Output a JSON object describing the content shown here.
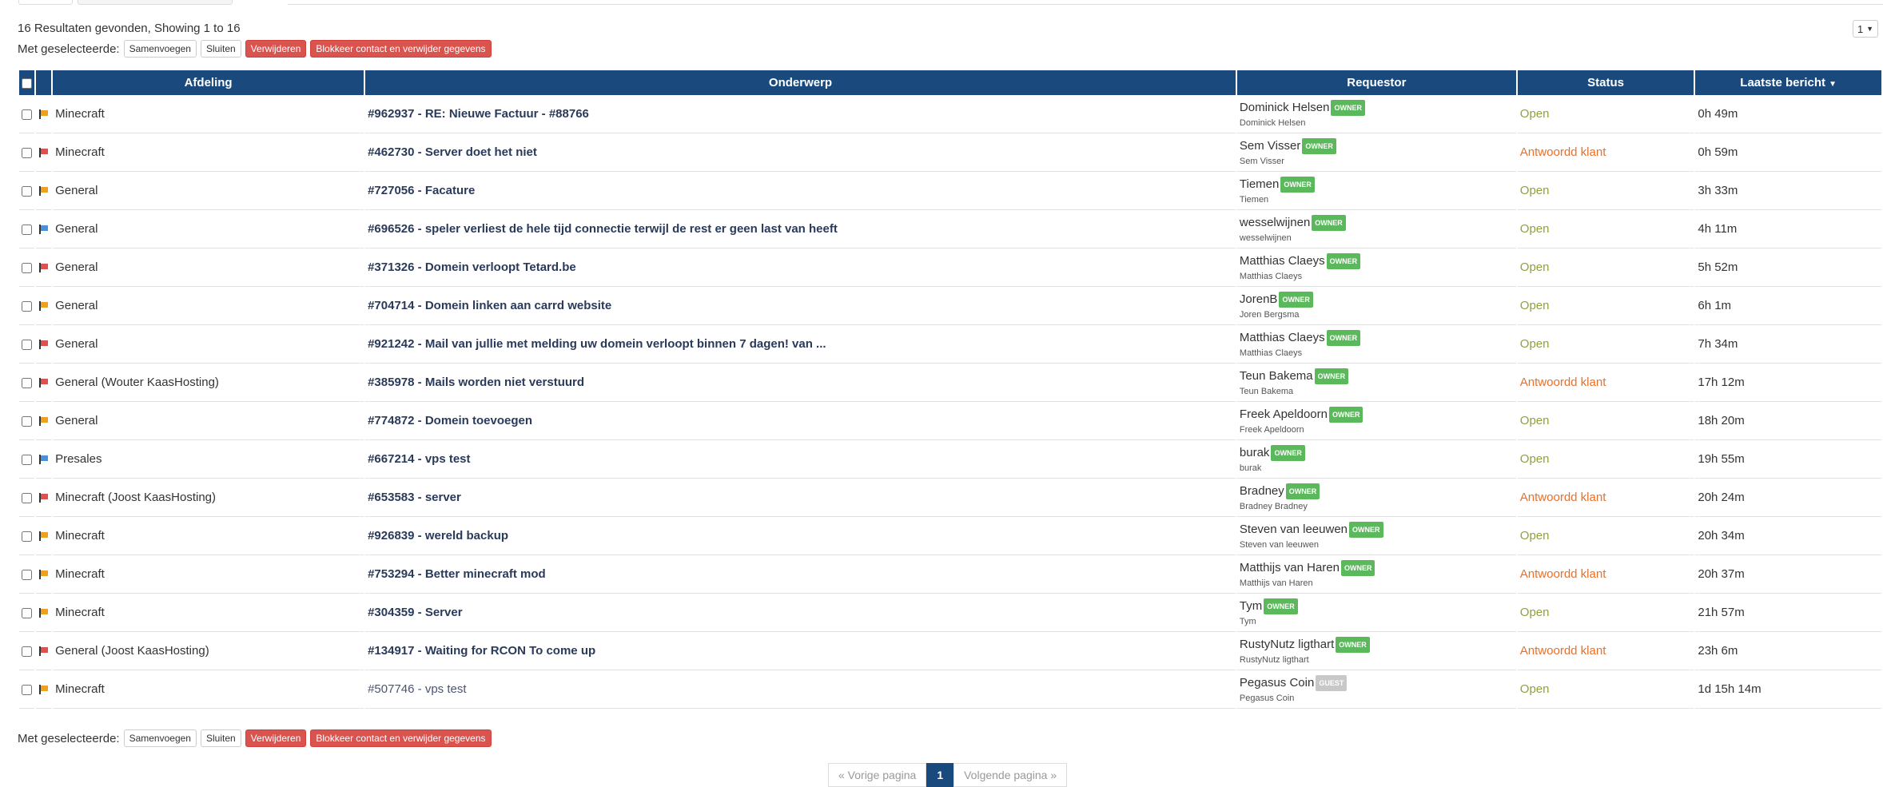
{
  "summary": "16 Resultaten gevonden, Showing 1 to 16",
  "page_select": "1",
  "mass_actions": {
    "label": "Met geselecteerde:",
    "merge": "Samenvoegen",
    "close": "Sluiten",
    "delete": "Verwijderen",
    "block": "Blokkeer contact en verwijder gegevens"
  },
  "columns": {
    "department": "Afdeling",
    "subject": "Onderwerp",
    "requestor": "Requestor",
    "status": "Status",
    "last_reply": "Laatste bericht"
  },
  "sort_icon": "caret-down-icon",
  "colors": {
    "header": "#1a4a7d",
    "open": "#8ca23a",
    "awaiting": "#e8702a",
    "owner_badge": "#5cb85c",
    "flag_orange": "#f0a020",
    "flag_red": "#d9534f",
    "flag_blue": "#4a90d9"
  },
  "tickets": [
    {
      "flag": "orange",
      "department": "Minecraft",
      "subject": "#962937 - RE: Nieuwe Factuur - #88766",
      "name": "Dominick Helsen",
      "badge": "OWNER",
      "sub": "Dominick Helsen",
      "status": "Open",
      "last": "0h 49m"
    },
    {
      "flag": "red",
      "department": "Minecraft",
      "subject": "#462730 - Server doet het niet",
      "name": "Sem Visser",
      "badge": "OWNER",
      "sub": "Sem Visser",
      "status": "Antwoordd klant",
      "last": "0h 59m"
    },
    {
      "flag": "orange",
      "department": "General",
      "subject": "#727056 - Facature",
      "name": "Tiemen",
      "badge": "OWNER",
      "sub": "Tiemen",
      "status": "Open",
      "last": "3h 33m"
    },
    {
      "flag": "blue",
      "department": "General",
      "subject": "#696526 - speler verliest de hele tijd connectie terwijl de rest er geen last van heeft",
      "name": "wesselwijnen",
      "badge": "OWNER",
      "sub": "wesselwijnen",
      "status": "Open",
      "last": "4h 11m"
    },
    {
      "flag": "red",
      "department": "General",
      "subject": "#371326 - Domein verloopt Tetard.be",
      "name": "Matthias Claeys",
      "badge": "OWNER",
      "sub": "Matthias Claeys",
      "status": "Open",
      "last": "5h 52m"
    },
    {
      "flag": "orange",
      "department": "General",
      "subject": "#704714 - Domein linken aan carrd website",
      "name": "JorenB",
      "badge": "OWNER",
      "sub": "Joren Bergsma",
      "status": "Open",
      "last": "6h 1m"
    },
    {
      "flag": "red",
      "department": "General",
      "subject": "#921242 - Mail van jullie met melding uw domein verloopt binnen 7 dagen! van ...",
      "name": "Matthias Claeys",
      "badge": "OWNER",
      "sub": "Matthias Claeys",
      "status": "Open",
      "last": "7h 34m"
    },
    {
      "flag": "red",
      "department": "General (Wouter KaasHosting)",
      "subject": "#385978 - Mails worden niet verstuurd",
      "name": "Teun Bakema",
      "badge": "OWNER",
      "sub": "Teun Bakema",
      "status": "Antwoordd klant",
      "last": "17h 12m"
    },
    {
      "flag": "orange",
      "department": "General",
      "subject": "#774872 - Domein toevoegen",
      "name": "Freek Apeldoorn",
      "badge": "OWNER",
      "sub": "Freek Apeldoorn",
      "status": "Open",
      "last": "18h 20m"
    },
    {
      "flag": "blue",
      "department": "Presales",
      "subject": "#667214 - vps test",
      "name": "burak",
      "badge": "OWNER",
      "sub": "burak",
      "status": "Open",
      "last": "19h 55m"
    },
    {
      "flag": "red",
      "department": "Minecraft (Joost KaasHosting)",
      "subject": "#653583 - server",
      "name": "Bradney",
      "badge": "OWNER",
      "sub": "Bradney Bradney",
      "status": "Antwoordd klant",
      "last": "20h 24m"
    },
    {
      "flag": "orange",
      "department": "Minecraft",
      "subject": "#926839 - wereld backup",
      "name": "Steven van leeuwen",
      "badge": "OWNER",
      "sub": "Steven van leeuwen",
      "status": "Open",
      "last": "20h 34m"
    },
    {
      "flag": "orange",
      "department": "Minecraft",
      "subject": "#753294 - Better minecraft mod",
      "name": "Matthijs van Haren",
      "badge": "OWNER",
      "sub": "Matthijs van Haren",
      "status": "Antwoordd klant",
      "last": "20h 37m"
    },
    {
      "flag": "orange",
      "department": "Minecraft",
      "subject": "#304359 - Server",
      "name": "Tym",
      "badge": "OWNER",
      "sub": "Tym",
      "status": "Open",
      "last": "21h 57m"
    },
    {
      "flag": "red",
      "department": "General (Joost KaasHosting)",
      "subject": "#134917 - Waiting for RCON To come up",
      "name": "RustyNutz ligthart",
      "badge": "OWNER",
      "sub": "RustyNutz ligthart",
      "status": "Antwoordd klant",
      "last": "23h 6m"
    },
    {
      "flag": "orange",
      "department": "Minecraft",
      "subject": "#507746 - vps test",
      "name": "Pegasus Coin",
      "badge": "GUEST",
      "sub": "Pegasus Coin",
      "status": "Open",
      "last": "1d 15h 14m"
    }
  ],
  "pagination": {
    "prev": "« Vorige pagina",
    "current": "1",
    "next": "Volgende pagina »"
  }
}
